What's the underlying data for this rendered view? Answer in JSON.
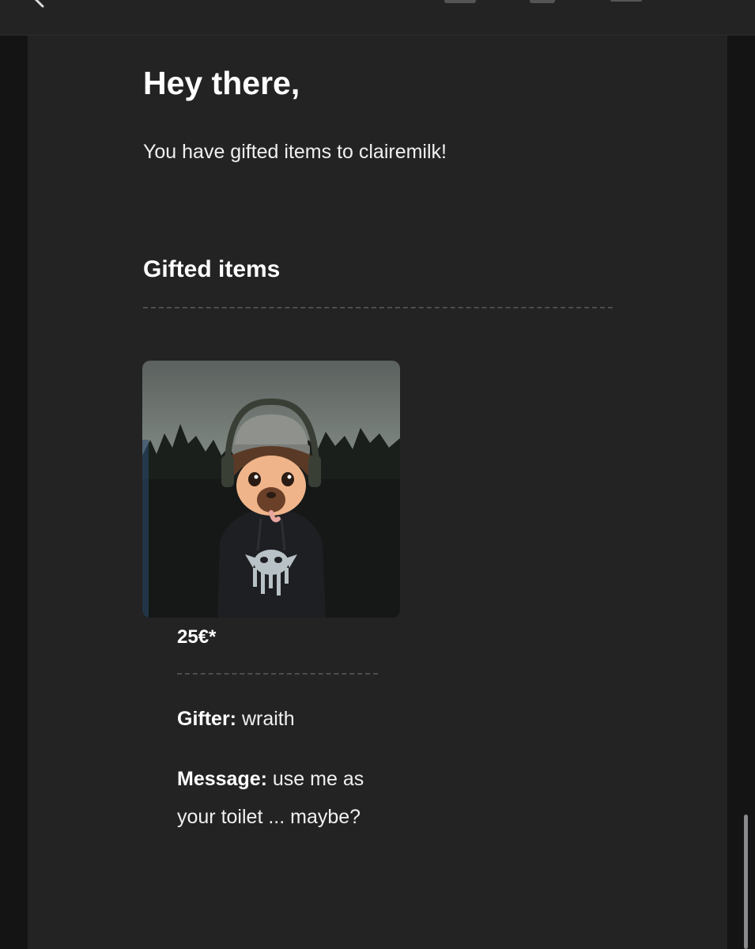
{
  "email": {
    "greeting": "Hey there,",
    "intro": "You have gifted items to clairemilk!",
    "section_title": "Gifted items",
    "item": {
      "price": "25€*",
      "gifter_label": "Gifter:",
      "gifter_value": "wraith",
      "message_label": "Message:",
      "message_value": "use me as your toilet ... maybe?"
    }
  },
  "colors": {
    "background": "#151516",
    "panel": "#232323",
    "toolbar": "#232324",
    "text": "#f2f2f2",
    "divider": "#4d4d4f"
  },
  "icons": [
    "back-chevron-icon",
    "toolbar-button-icon"
  ]
}
